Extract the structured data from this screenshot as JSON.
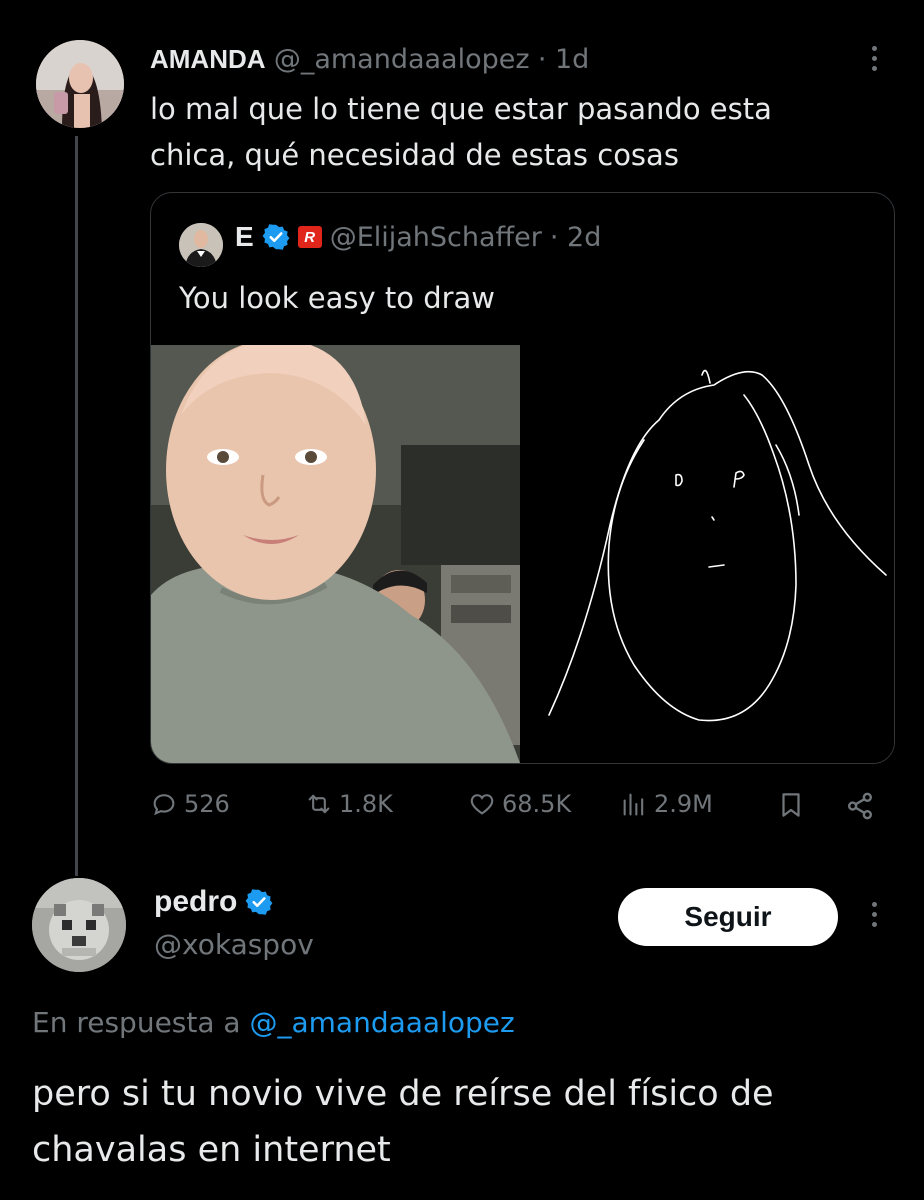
{
  "tweet": {
    "display_name": "AMANDA",
    "handle": "@_amandaaalopez",
    "time": "· 1d",
    "text_line1": "lo mal que lo tiene que estar pasando esta",
    "text_line2": "chica, qué necesidad de estas cosas"
  },
  "quote": {
    "display_name": "E",
    "badge_text": "R",
    "handle": "@ElijahSchaffer",
    "time": "· 2d",
    "text": "You look easy to draw"
  },
  "actions": {
    "replies": "526",
    "reposts": "1.8K",
    "likes": "68.5K",
    "views": "2.9M"
  },
  "reply": {
    "display_name": "pedro",
    "handle": "@xokaspov",
    "follow_label": "Seguir",
    "replying_prefix": "En respuesta a",
    "replying_to": "@_amandaaalopez",
    "text_line1": "pero si tu novio vive de reírse del físico de",
    "text_line2": "chavalas en internet"
  },
  "colors": {
    "background": "#000000",
    "text": "#e7e9ea",
    "muted": "#71767b",
    "accent": "#1d9bf0"
  }
}
